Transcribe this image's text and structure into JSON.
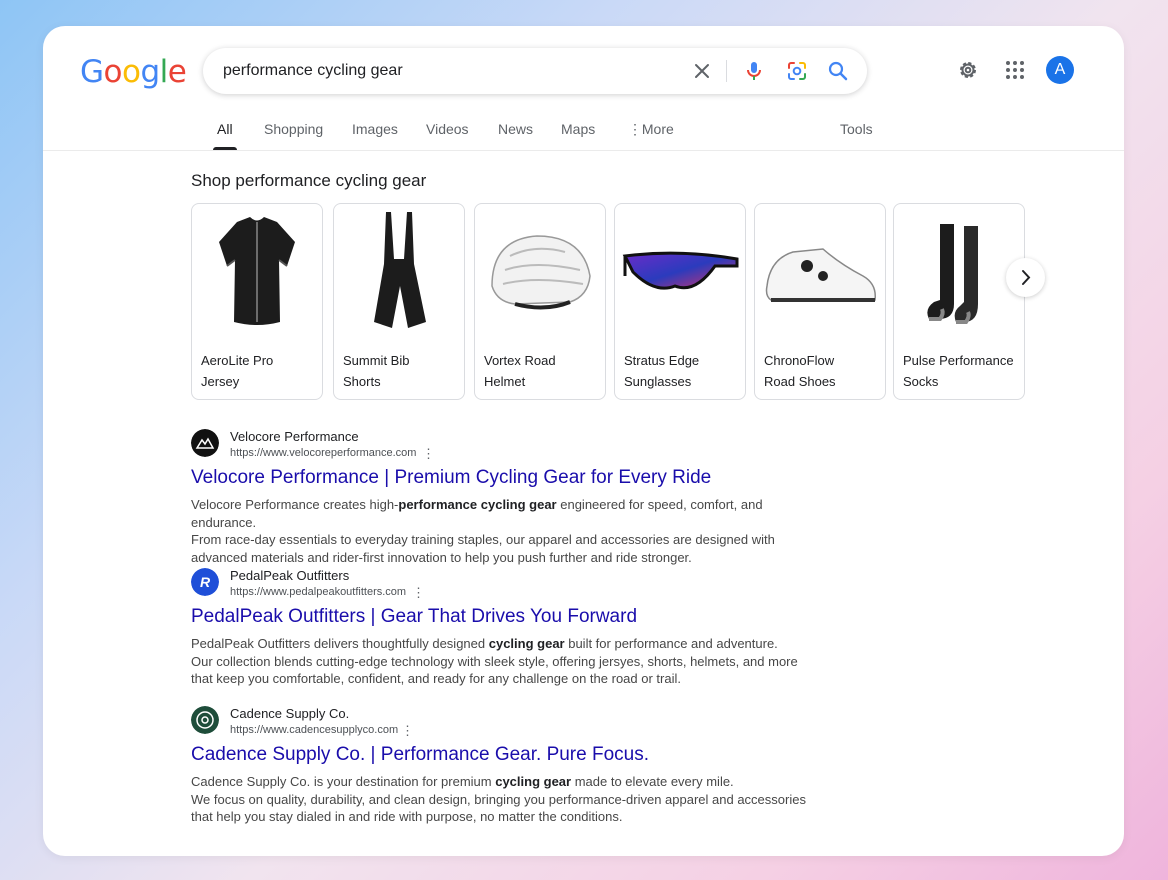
{
  "search": {
    "query": "performance cycling gear"
  },
  "header": {
    "avatar_letter": "A"
  },
  "tabs": [
    {
      "label": "All"
    },
    {
      "label": "Shopping"
    },
    {
      "label": "Images"
    },
    {
      "label": "Videos"
    },
    {
      "label": "News"
    },
    {
      "label": "Maps"
    },
    {
      "label": "More"
    },
    {
      "label": "Tools"
    }
  ],
  "shopping": {
    "title": "Shop performance cycling gear",
    "products": [
      {
        "line1": "AeroLite Pro",
        "line2": "Jersey",
        "icon": "jersey-icon"
      },
      {
        "line1": "Summit Bib",
        "line2": "Shorts",
        "icon": "bib-shorts-icon"
      },
      {
        "line1": "Vortex Road",
        "line2": "Helmet",
        "icon": "helmet-icon"
      },
      {
        "line1": "Stratus Edge",
        "line2": "Sunglasses",
        "icon": "sunglasses-icon"
      },
      {
        "line1": "ChronoFlow",
        "line2": "Road Shoes",
        "icon": "shoe-icon"
      },
      {
        "line1": "Pulse Performance",
        "line2": "Socks",
        "icon": "socks-icon"
      }
    ]
  },
  "results": [
    {
      "site": "Velocore Performance",
      "url": "https://www.velocoreperformance.com",
      "title": "Velocore Performance | Premium Cycling Gear for Every Ride",
      "lines": [
        [
          "Velocore Performance creates high-",
          "performance cycling gear",
          " engineered for speed, comfort, and endurance."
        ],
        [
          "From race-day essentials to everyday training staples, our apparel and accessories are designed with"
        ],
        [
          "advanced materials and rider-first innovation to help you push further and ride stronger."
        ]
      ],
      "favicon_color": "#111111"
    },
    {
      "site": "PedalPeak Outfitters",
      "url": "https://www.pedalpeakoutfitters.com",
      "title": "PedalPeak Outfitters | Gear That Drives You Forward",
      "lines": [
        [
          "PedalPeak Outfitters delivers thoughtfully designed ",
          "cycling gear",
          " built for performance and adventure."
        ],
        [
          "Our collection blends cutting-edge technology with sleek style, offering jersyes, shorts, helmets, and more"
        ],
        [
          "that keep you comfortable, confident, and ready for any challenge on the road or trail."
        ]
      ],
      "favicon_color": "#1f4fd8"
    },
    {
      "site": "Cadence Supply Co.",
      "url": "https://www.cadencesupplyco.com",
      "title": "Cadence Supply Co. | Performance Gear. Pure Focus.",
      "lines": [
        [
          "Cadence Supply Co. is your destination for premium ",
          "cycling gear",
          " made to elevate every mile."
        ],
        [
          "We focus on quality, durability, and clean design, bringing you performance-driven apparel and accessories"
        ],
        [
          "that help you stay dialed in and ride with purpose, no matter the conditions."
        ]
      ],
      "favicon_color": "#1e4d3a"
    }
  ]
}
